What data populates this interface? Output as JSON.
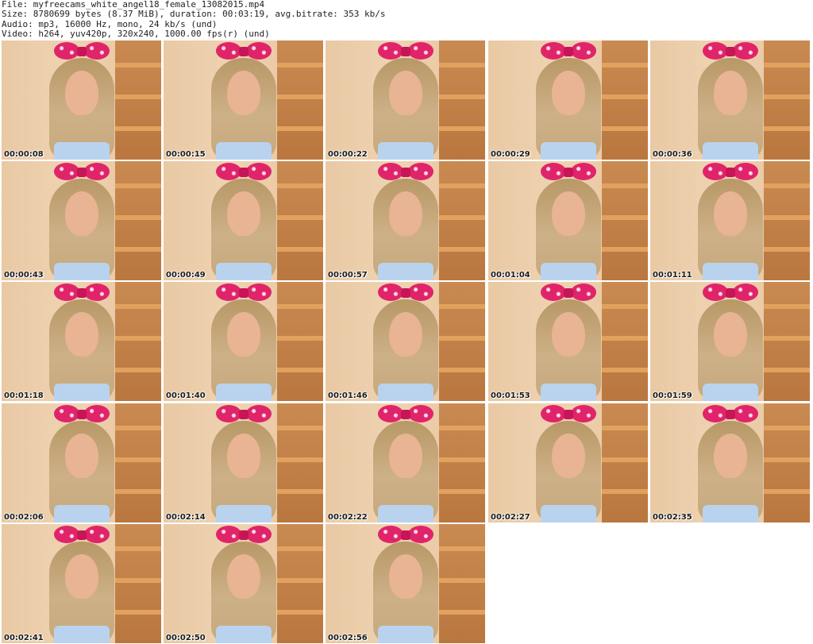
{
  "header": {
    "file_line": "File: myfreecams_white_angel18_female_13082015.mp4",
    "size_line": "Size: 8780699 bytes (8.37 MiB), duration: 00:03:19, avg.bitrate: 353 kb/s",
    "audio_line": "Audio: mp3, 16000 Hz, mono, 24 kb/s (und)",
    "video_line": "Video: h264, yuv420p, 320x240, 1000.00 fps(r) (und)"
  },
  "thumbnails": [
    {
      "timestamp": "00:00:08"
    },
    {
      "timestamp": "00:00:15"
    },
    {
      "timestamp": "00:00:22"
    },
    {
      "timestamp": "00:00:29"
    },
    {
      "timestamp": "00:00:36"
    },
    {
      "timestamp": "00:00:43"
    },
    {
      "timestamp": "00:00:49"
    },
    {
      "timestamp": "00:00:57"
    },
    {
      "timestamp": "00:01:04"
    },
    {
      "timestamp": "00:01:11"
    },
    {
      "timestamp": "00:01:18"
    },
    {
      "timestamp": "00:01:40"
    },
    {
      "timestamp": "00:01:46"
    },
    {
      "timestamp": "00:01:53"
    },
    {
      "timestamp": "00:01:59"
    },
    {
      "timestamp": "00:02:06"
    },
    {
      "timestamp": "00:02:14"
    },
    {
      "timestamp": "00:02:22"
    },
    {
      "timestamp": "00:02:27"
    },
    {
      "timestamp": "00:02:35"
    },
    {
      "timestamp": "00:02:41"
    },
    {
      "timestamp": "00:02:50"
    },
    {
      "timestamp": "00:02:56"
    }
  ],
  "colors": {
    "background": "#ffffff",
    "header_text": "#222222",
    "bow": "#e0246a",
    "wall": "#ecceac",
    "shelf": "#c98a52"
  }
}
